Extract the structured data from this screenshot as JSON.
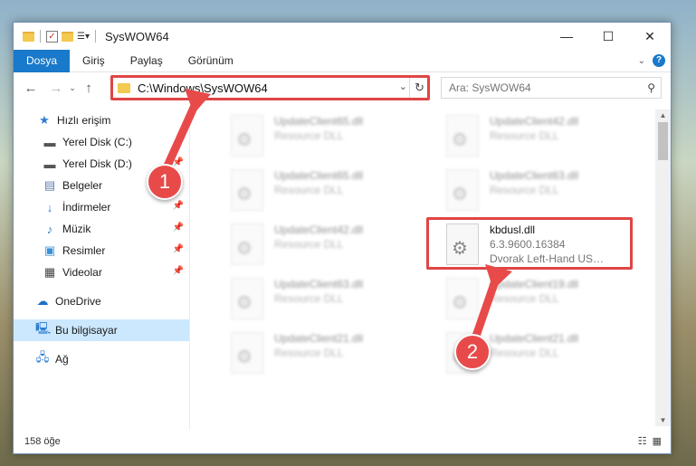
{
  "window": {
    "title": "SysWOW64",
    "controls": {
      "minimize": "—",
      "maximize": "☐",
      "close": "✕"
    }
  },
  "ribbon": {
    "tabs": [
      "Dosya",
      "Giriş",
      "Paylaş",
      "Görünüm"
    ],
    "active_tab": "Dosya"
  },
  "address": {
    "path": "C:\\Windows\\SysWOW64"
  },
  "search": {
    "placeholder": "Ara: SysWOW64"
  },
  "sidebar": {
    "items": [
      {
        "label": "Hızlı erişim",
        "icon": "star-icon",
        "pinned": false
      },
      {
        "label": "Yerel Disk (C:)",
        "icon": "drive-icon",
        "pinned": false
      },
      {
        "label": "Yerel Disk (D:)",
        "icon": "drive-icon",
        "pinned": true
      },
      {
        "label": "Belgeler",
        "icon": "document-icon",
        "pinned": true
      },
      {
        "label": "İndirmeler",
        "icon": "download-icon",
        "pinned": true
      },
      {
        "label": "Müzik",
        "icon": "music-icon",
        "pinned": true
      },
      {
        "label": "Resimler",
        "icon": "pictures-icon",
        "pinned": true
      },
      {
        "label": "Videolar",
        "icon": "video-icon",
        "pinned": true
      },
      {
        "label": "OneDrive",
        "icon": "cloud-icon",
        "pinned": false
      },
      {
        "label": "Bu bilgisayar",
        "icon": "computer-icon",
        "pinned": false,
        "selected": true
      },
      {
        "label": "Ağ",
        "icon": "network-icon",
        "pinned": false
      }
    ]
  },
  "files": [
    {
      "name": "UpdateClient65.dll",
      "sub": "Resource DLL",
      "blurred": true
    },
    {
      "name": "UpdateClient42.dll",
      "sub": "Resource DLL",
      "blurred": true
    },
    {
      "name": "UpdateClient65.dll",
      "sub": "Resource DLL",
      "blurred": true
    },
    {
      "name": "UpdateClient63.dll",
      "sub": "Resource DLL",
      "blurred": true
    },
    {
      "name": "UpdateClient42.dll",
      "sub": "Resource DLL",
      "blurred": true
    },
    {
      "name": "kbdusl.dll",
      "sub": "6.3.9600.16384",
      "sub2": "Dvorak Left-Hand US…",
      "blurred": false
    },
    {
      "name": "UpdateClient63.dll",
      "sub": "Resource DLL",
      "blurred": true
    },
    {
      "name": "UpdateClient19.dll",
      "sub": "Resource DLL",
      "blurred": true
    },
    {
      "name": "UpdateClient21.dll",
      "sub": "Resource DLL",
      "blurred": true
    },
    {
      "name": "UpdateClient21.dll",
      "sub": "Resource DLL",
      "blurred": true
    }
  ],
  "status": {
    "item_count": "158 öğe"
  },
  "annotations": {
    "step1": "1",
    "step2": "2",
    "color": "#e04545"
  }
}
